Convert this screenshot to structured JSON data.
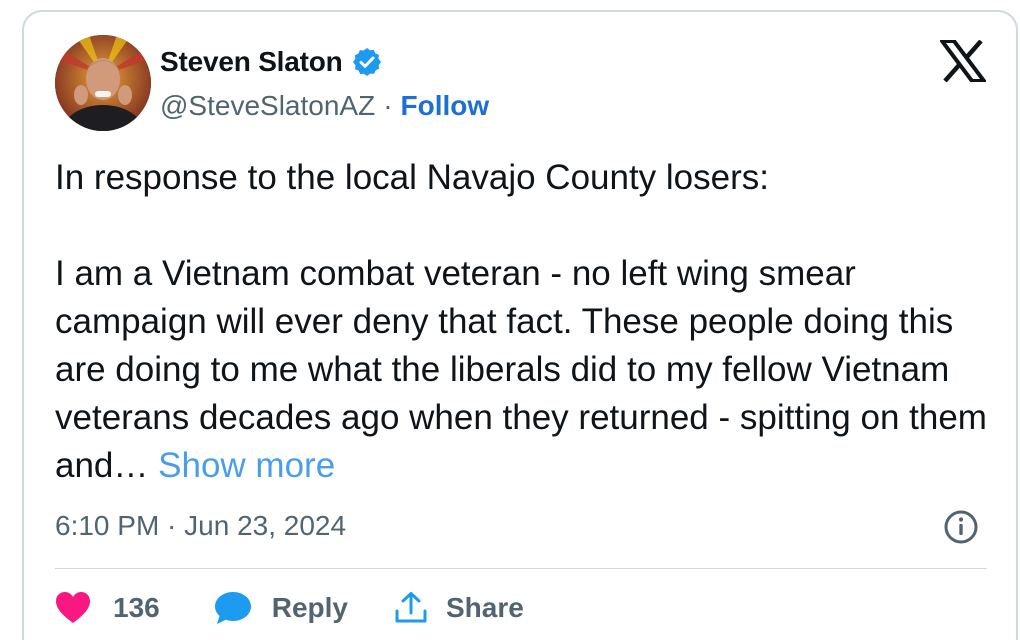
{
  "author": {
    "name": "Steven Slaton",
    "handle": "@SteveSlatonAZ",
    "separator": "·",
    "follow_label": "Follow",
    "verified_color": "#1d9bf0"
  },
  "tweet": {
    "line1": "In response to the local Navajo County losers:",
    "body": "I am a Vietnam combat veteran - no left wing smear campaign will ever deny that fact. These people doing this are doing to me what the liberals did to my fellow Vietnam veterans decades ago when they returned - spitting on them and…",
    "show_more_label": "Show more",
    "timestamp": "6:10 PM · Jun 23, 2024"
  },
  "actions": {
    "like_count": "136",
    "reply_label": "Reply",
    "share_label": "Share",
    "like_color": "#f91880",
    "reply_color": "#1d9bf0",
    "share_color": "#1d9bf0"
  },
  "icons": {
    "platform": "x-logo-icon",
    "info": "info-icon",
    "like": "heart-icon",
    "reply": "speech-bubble-icon",
    "share": "share-upload-icon",
    "verified": "verified-badge-icon"
  }
}
